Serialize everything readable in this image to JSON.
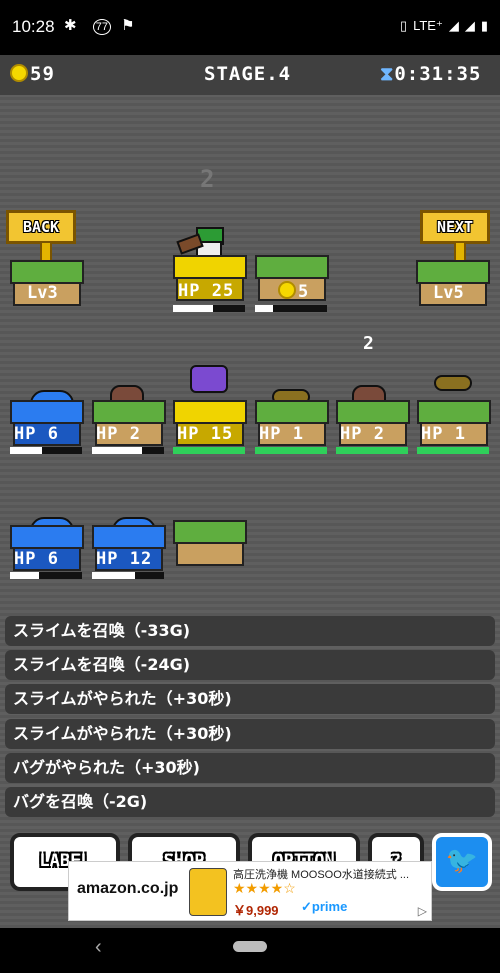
{
  "status_bar": {
    "time": "10:28",
    "network": "LTE⁺",
    "notifications": [
      "slack",
      "77",
      "sign"
    ]
  },
  "hud": {
    "coins": "59",
    "stage": "STAGE.4",
    "timer": "0:31:35"
  },
  "floating_numbers": [
    "2",
    "2"
  ],
  "nav": {
    "back_label": "BACK",
    "next_label": "NEXT",
    "back_level": "Lv3",
    "next_level": "Lv5"
  },
  "top_row": [
    {
      "label": "HP 25",
      "hp_fraction": 0.55,
      "kind": "hero"
    },
    {
      "label": "5",
      "hp_fraction": 0.25,
      "kind": "coin"
    }
  ],
  "middle_row": [
    {
      "label": "HP  6",
      "hp_fraction": 0.45,
      "tile": "blue"
    },
    {
      "label": "HP  2",
      "hp_fraction": 0.7,
      "tile": "grass"
    },
    {
      "label": "HP 15",
      "hp_fraction": 1.0,
      "tile": "yellow"
    },
    {
      "label": "HP  1",
      "hp_fraction": 1.0,
      "tile": "grass"
    },
    {
      "label": "HP  2",
      "hp_fraction": 1.0,
      "tile": "grass"
    },
    {
      "label": "HP  1",
      "hp_fraction": 1.0,
      "tile": "grass"
    }
  ],
  "bottom_row": [
    {
      "label": "HP  6",
      "hp_fraction": 0.4,
      "tile": "blue"
    },
    {
      "label": "HP 12",
      "hp_fraction": 0.6,
      "tile": "blue"
    }
  ],
  "log": [
    "スライムを召喚（-33G)",
    "スライムを召喚（-24G)",
    "スライムがやられた（+30秒)",
    "スライムがやられた（+30秒)",
    "バグがやられた（+30秒)",
    "バグを召喚（-2G)"
  ],
  "buttons": {
    "label": "LABEL",
    "shop": "SHOP",
    "option": "OPTION",
    "help": "?"
  },
  "ad": {
    "brand": "amazon.co.jp",
    "title": "高圧洗浄機 MOOSOO水道接続式 ...",
    "stars": "★★★★☆",
    "price": "￥9,999",
    "prime": "✓prime"
  },
  "colors": {
    "hud_bg": "#404040",
    "tile_grass": "#5fae3f",
    "tile_yellow": "#f0d400",
    "tile_blue": "#2b7cf0",
    "twitter": "#1c8ef0"
  }
}
